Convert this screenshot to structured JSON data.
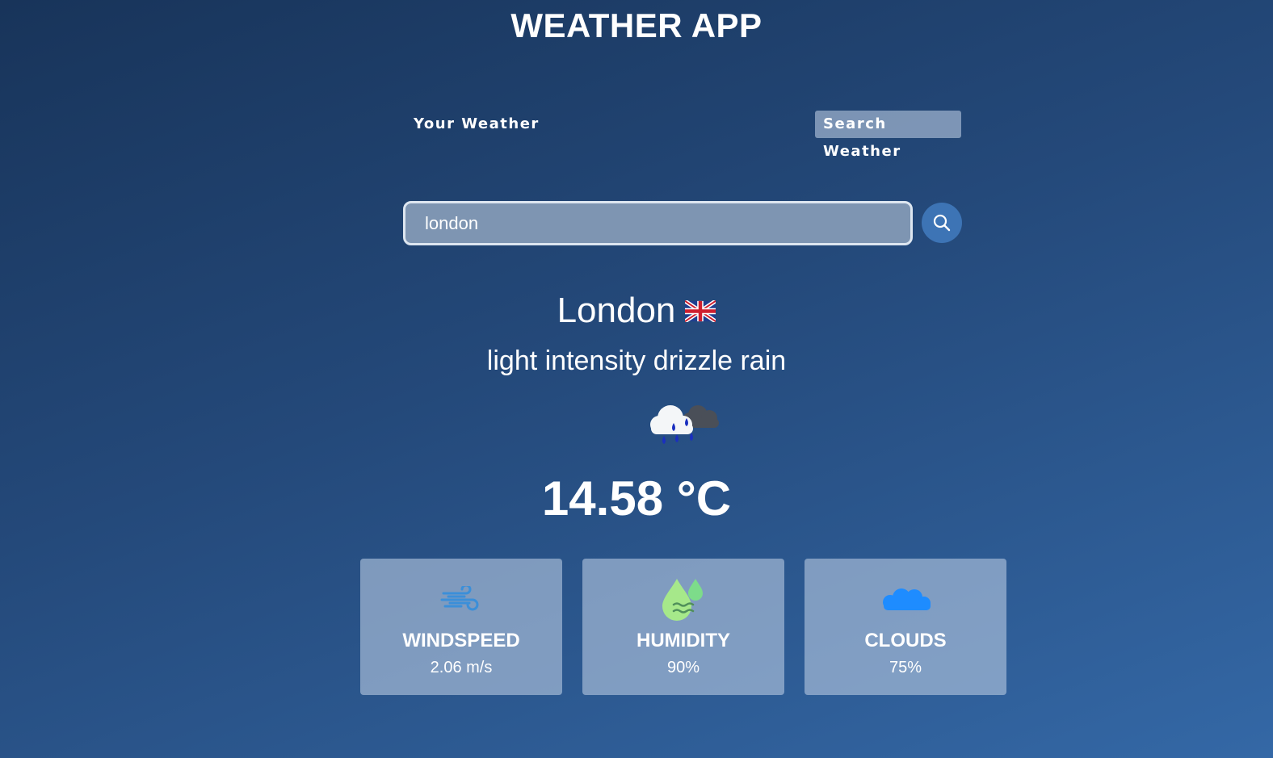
{
  "app_title": "WEATHER APP",
  "tabs": {
    "your_weather": "Your Weather",
    "search_weather": "Search Weather"
  },
  "search": {
    "value": "london",
    "icon": "search-icon"
  },
  "weather": {
    "city": "London",
    "flag_icon": "uk-flag-icon",
    "description": "light intensity drizzle rain",
    "condition_icon": "drizzle-rain-icon",
    "temperature": "14.58 °C"
  },
  "cards": [
    {
      "label": "WINDSPEED",
      "value": "2.06 m/s",
      "icon": "wind-icon"
    },
    {
      "label": "HUMIDITY",
      "value": "90%",
      "icon": "humidity-icon"
    },
    {
      "label": "CLOUDS",
      "value": "75%",
      "icon": "clouds-icon"
    }
  ],
  "colors": {
    "background_top": "#18345a",
    "background_bottom": "#3468a6",
    "search_button": "#3d74b5",
    "card_bg": "#8ba3c4",
    "wind_icon": "#3b8fd9",
    "humidity_icon": "#a6e88a",
    "clouds_icon": "#1e8cff"
  }
}
